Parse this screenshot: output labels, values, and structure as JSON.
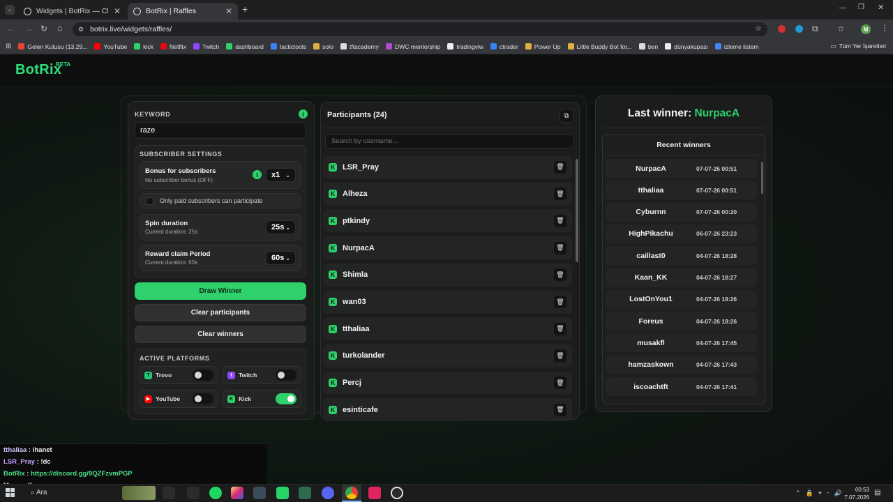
{
  "browser": {
    "tabs": [
      {
        "title": "Widgets | BotRix — Cloud Strea",
        "active": false
      },
      {
        "title": "BotRix | Raffles",
        "active": true
      }
    ],
    "url": "botrix.live/widgets/raffles/",
    "profile_initial": "M",
    "bookmarks": [
      {
        "label": "Gelen Kutusu (13.29...",
        "color": "#ea4335"
      },
      {
        "label": "YouTube",
        "color": "#ff0000"
      },
      {
        "label": "kick",
        "color": "#2ed16b"
      },
      {
        "label": "Netflix",
        "color": "#e50914"
      },
      {
        "label": "Twitch",
        "color": "#9146ff"
      },
      {
        "label": "dashboard",
        "color": "#2ed16b"
      },
      {
        "label": "tactictools",
        "color": "#3b82f6"
      },
      {
        "label": "solo",
        "color": "#e0b040"
      },
      {
        "label": "tftacademy",
        "color": "#dddddd"
      },
      {
        "label": "DWC mentorship",
        "color": "#b04ad0"
      },
      {
        "label": "tradingviw",
        "color": "#eeeeee"
      },
      {
        "label": "ctrader",
        "color": "#3b82f6"
      },
      {
        "label": "Power Up",
        "color": "#e0b040"
      },
      {
        "label": "Little Buddy Bot for...",
        "color": "#e0b040"
      },
      {
        "label": "ben",
        "color": "#dddddd"
      },
      {
        "label": "dünyakupası",
        "color": "#eeeeee"
      },
      {
        "label": "izleme listem",
        "color": "#4285f4"
      }
    ],
    "all_bookmarks": "Tüm Yer İşaretleri"
  },
  "app": {
    "logo": "BotRix",
    "badge": "BETA"
  },
  "settings": {
    "keyword_label": "KEYWORD",
    "keyword_value": "raze",
    "subscriber_section": "SUBSCRIBER SETTINGS",
    "bonus_title": "Bonus for subscribers",
    "bonus_sub": "No subscriber bonus (OFF)",
    "bonus_value": "x1",
    "only_paid_label": "Only paid subscribers can participate",
    "spin_title": "Spin duration",
    "spin_sub": "Current duration: 25s",
    "spin_value": "25s",
    "reward_title": "Reward claim Period",
    "reward_sub": "Current duration: 60s",
    "reward_value": "60s",
    "draw_button": "Draw Winner",
    "clear_participants_button": "Clear participants",
    "clear_winners_button": "Clear winners",
    "platforms_label": "ACTIVE PLATFORMS",
    "platforms": [
      {
        "name": "Trovo",
        "enabled": false,
        "color": "#21c87a"
      },
      {
        "name": "Twitch",
        "enabled": false,
        "color": "#9146ff"
      },
      {
        "name": "YouTube",
        "enabled": false,
        "color": "#ff0000"
      },
      {
        "name": "Kick",
        "enabled": true,
        "color": "#2ed16b"
      }
    ]
  },
  "participants": {
    "title": "Participants (24)",
    "search_placeholder": "Search by username...",
    "list": [
      "LSR_Pray",
      "Alheza",
      "ptkindy",
      "NurpacA",
      "Shimla",
      "wan03",
      "tthaliaa",
      "turkolander",
      "Percj",
      "esinticafe"
    ]
  },
  "winners": {
    "last_winner_label": "Last winner:",
    "last_winner_name": "NurpacA",
    "recent_title": "Recent winners",
    "list": [
      {
        "name": "NurpacA",
        "time": "07-07-26 00:51"
      },
      {
        "name": "tthaliaa",
        "time": "07-07-26 00:51"
      },
      {
        "name": "Cyburnn",
        "time": "07-07-26 00:20"
      },
      {
        "name": "HighPikachu",
        "time": "06-07-26 23:23"
      },
      {
        "name": "caillast0",
        "time": "04-07-26 18:28"
      },
      {
        "name": "Kaan_KK",
        "time": "04-07-26 18:27"
      },
      {
        "name": "LostOnYou1",
        "time": "04-07-26 18:26"
      },
      {
        "name": "Foreus",
        "time": "04-07-26 18:26"
      },
      {
        "name": "musakfl",
        "time": "04-07-26 17:45"
      },
      {
        "name": "hamzaskown",
        "time": "04-07-26 17:43"
      },
      {
        "name": "iscoachtft",
        "time": "04-07-26 17:41"
      }
    ]
  },
  "chat": [
    {
      "user": "tthaliaa",
      "message": "ihanet",
      "color": "#c8c8ff"
    },
    {
      "user": "LSR_Pray",
      "message": "!dc",
      "color": "#c8a0ff"
    },
    {
      "user": "BotRix",
      "message": "https://discord.gg/9QZFzvmPGP",
      "color": "#4fe08a"
    },
    {
      "user": "Monroeff",
      "message": "",
      "color": "#c0c0c0"
    }
  ],
  "overlay_url": "https://... /team/surf/9kaRX5",
  "taskbar": {
    "search": "Ara",
    "time": "00:53",
    "date": "7.07.2026"
  }
}
